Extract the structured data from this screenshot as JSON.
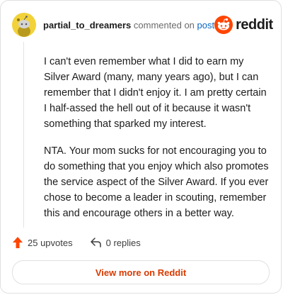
{
  "header": {
    "username": "partial_to_dreamers",
    "commented_text": "commented on",
    "post_link": "post",
    "brand": "reddit"
  },
  "comment": {
    "paragraphs": [
      "I can't even remember what I did to earn my Silver Award (many, many years ago), but I can remember that I didn't enjoy it. I am pretty certain I half-assed the hell out of it because it wasn't something that sparked my interest.",
      "NTA. Your mom sucks for not encouraging you to do something that you enjoy which also promotes the service aspect of the Silver Award. If you ever chose to become a leader in scouting, remember this and encourage others in a better way."
    ]
  },
  "actions": {
    "upvotes": "25 upvotes",
    "replies": "0 replies"
  },
  "footer": {
    "view_more": "View more on Reddit"
  },
  "colors": {
    "upvote": "#ff4500",
    "link": "#0a66c2",
    "view_more": "#d93a00",
    "avatar": "#f2d23a"
  },
  "icons": {
    "avatar": "snoo-avatar-icon",
    "brand": "reddit-logo-icon",
    "upvote": "upvote-arrow-icon",
    "reply": "reply-arrow-icon"
  }
}
